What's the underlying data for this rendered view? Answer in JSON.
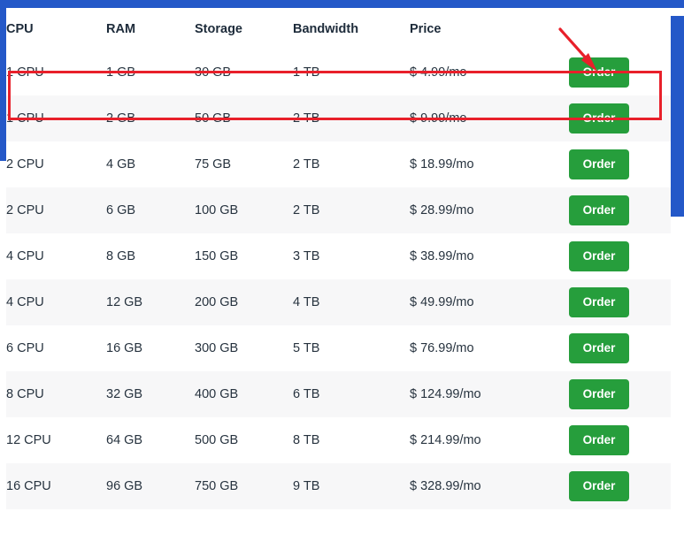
{
  "page": {
    "title": "VPS Hosting Pricing Table",
    "accent_blue": "#2458c8",
    "order_button_green": "#269e3c",
    "annotation_red": "#e8202a",
    "row_alt_background": "#f7f7f8"
  },
  "table": {
    "headers": [
      "CPU",
      "RAM",
      "Storage",
      "Bandwidth",
      "Price",
      ""
    ],
    "action_label": "Order",
    "rows": [
      {
        "cpu": "1 CPU",
        "ram": "1 GB",
        "storage": "30 GB",
        "bandwidth": "1 TB",
        "price": "$ 4.99/mo",
        "action": "Order"
      },
      {
        "cpu": "1 CPU",
        "ram": "2 GB",
        "storage": "50 GB",
        "bandwidth": "2 TB",
        "price": "$ 9.99/mo",
        "action": "Order"
      },
      {
        "cpu": "2 CPU",
        "ram": "4 GB",
        "storage": "75 GB",
        "bandwidth": "2 TB",
        "price": "$ 18.99/mo",
        "action": "Order"
      },
      {
        "cpu": "2 CPU",
        "ram": "6 GB",
        "storage": "100 GB",
        "bandwidth": "2 TB",
        "price": "$ 28.99/mo",
        "action": "Order"
      },
      {
        "cpu": "4 CPU",
        "ram": "8 GB",
        "storage": "150 GB",
        "bandwidth": "3 TB",
        "price": "$ 38.99/mo",
        "action": "Order"
      },
      {
        "cpu": "4 CPU",
        "ram": "12 GB",
        "storage": "200 GB",
        "bandwidth": "4 TB",
        "price": "$ 49.99/mo",
        "action": "Order"
      },
      {
        "cpu": "6 CPU",
        "ram": "16 GB",
        "storage": "300 GB",
        "bandwidth": "5 TB",
        "price": "$ 76.99/mo",
        "action": "Order"
      },
      {
        "cpu": "8 CPU",
        "ram": "32 GB",
        "storage": "400 GB",
        "bandwidth": "6 TB",
        "price": "$ 124.99/mo",
        "action": "Order"
      },
      {
        "cpu": "12 CPU",
        "ram": "64 GB",
        "storage": "500 GB",
        "bandwidth": "8 TB",
        "price": "$ 214.99/mo",
        "action": "Order"
      },
      {
        "cpu": "16 CPU",
        "ram": "96 GB",
        "storage": "750 GB",
        "bandwidth": "9 TB",
        "price": "$ 328.99/mo",
        "action": "Order"
      }
    ]
  },
  "annotations": {
    "highlight_target_row_index": 0,
    "arrow_points_to": "Order"
  }
}
